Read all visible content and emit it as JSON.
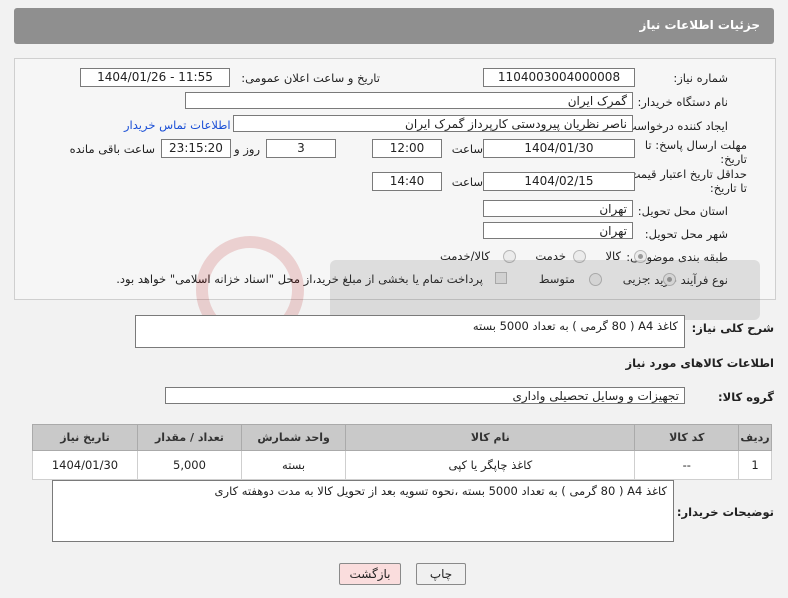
{
  "header": {
    "title": "جزئیات اطلاعات نیاز"
  },
  "fields": {
    "need_number_label": "شماره نیاز:",
    "need_number": "1104003004000008",
    "announce_label": "تاریخ و ساعت اعلان عمومی:",
    "announce_value": "1404/01/26 - 11:55",
    "buyer_org_label": "نام دستگاه خریدار:",
    "buyer_org": "گمرک ایران",
    "creator_label": "ایجاد کننده درخواست:",
    "creator": "ناصر نظریان پیرودستی کارپرداز گمرک ایران",
    "contact_link": "اطلاعات تماس خریدار",
    "deadline_label_1": "مهلت ارسال پاسخ: تا",
    "deadline_label_2": "تاریخ:",
    "deadline_date": "1404/01/30",
    "time_label": "ساعت",
    "deadline_time": "12:00",
    "days_value": "3",
    "days_label": "روز و",
    "remaining_time": "23:15:20",
    "remaining_label": "ساعت باقی مانده",
    "validity_label_1": "حداقل تاریخ اعتبار قیمت:",
    "validity_label_2": "تا تاریخ:",
    "validity_date": "1404/02/15",
    "validity_time": "14:40",
    "province_label": "استان محل تحویل:",
    "province": "تهران",
    "city_label": "شهر محل تحویل:",
    "city": "تهران",
    "category_label": "طبقه بندی موضوعی:",
    "category_options": [
      "کالا",
      "خدمت",
      "کالا/خدمت"
    ],
    "process_label": "نوع فرآیند خرید :",
    "process_options": [
      "جزیی",
      "متوسط"
    ],
    "payment_note": "پرداخت تمام یا بخشی از مبلغ خرید،از محل \"اسناد خزانه اسلامی\" خواهد بود."
  },
  "description": {
    "label": "شرح کلی نیاز:",
    "text": "کاغذ A4 ( 80 گرمی ) به تعداد 5000 بسته"
  },
  "goods_section": {
    "title": "اطلاعات کالاهای مورد نیاز",
    "group_label": "گروه کالا:",
    "group_value": "تجهیزات و وسایل تحصیلی واداری"
  },
  "table": {
    "headers": [
      "ردیف",
      "کد کالا",
      "نام کالا",
      "واحد شمارش",
      "تعداد / مقدار",
      "تاریخ نیاز"
    ],
    "rows": [
      [
        "1",
        "--",
        "کاغذ چاپگر یا کپی",
        "بسته",
        "5,000",
        "1404/01/30"
      ]
    ]
  },
  "buyer_notes": {
    "label": "توضیحات خریدار:",
    "text": "کاغذ A4 ( 80 گرمی ) به تعداد 5000 بسته ،نحوه تسویه بعد از تحویل کالا به مدت دوهفته کاری"
  },
  "buttons": {
    "print": "چاپ",
    "back": "بازگشت"
  },
  "colors": {
    "header_bg": "#8f8f8f",
    "link": "#1a4fd6",
    "back_btn_bg": "#fadddd"
  }
}
